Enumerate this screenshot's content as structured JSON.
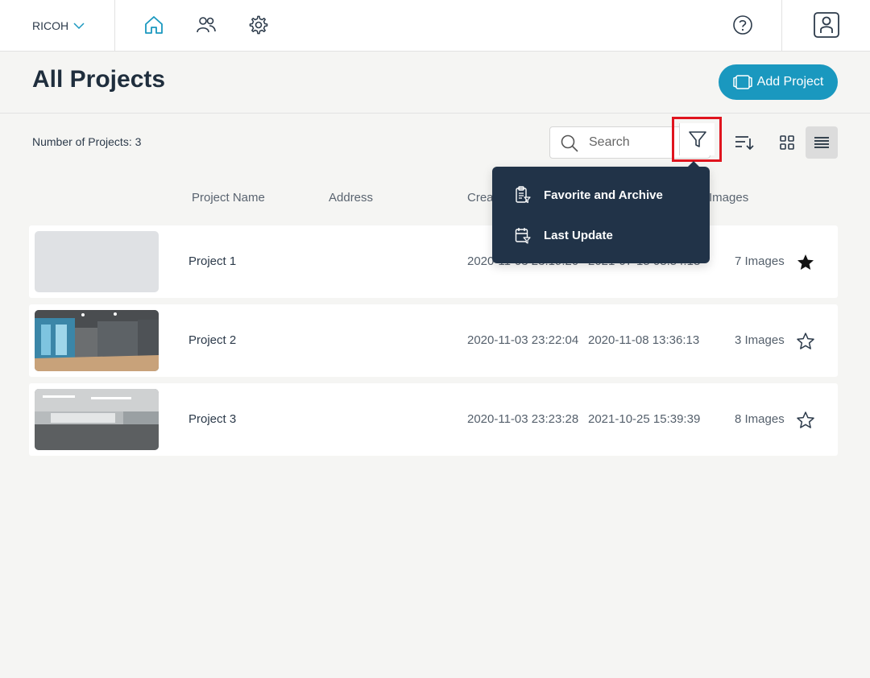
{
  "topbar": {
    "org_name": "RICOH",
    "nav_icons": [
      "home-icon",
      "users-icon",
      "settings-icon"
    ],
    "help_icon": "help-icon",
    "user_icon": "user-icon"
  },
  "header": {
    "title": "All Projects",
    "add_button_label": "Add Project"
  },
  "toolbar": {
    "project_count_label": "Number of Projects: 3",
    "search_placeholder": "Search"
  },
  "columns": {
    "name": "Project Name",
    "address": "Address",
    "created": "Crea",
    "images": "Images"
  },
  "filter_menu": {
    "items": [
      {
        "label": "Favorite and Archive",
        "icon": "clipboard-filter-icon"
      },
      {
        "label": "Last Update",
        "icon": "calendar-filter-icon"
      }
    ]
  },
  "projects": [
    {
      "name": "Project 1",
      "created": "2020-11-03 23:19:20",
      "updated": "2021-07-15 08:54:18",
      "images": "7 Images",
      "favorite": true
    },
    {
      "name": "Project 2",
      "created": "2020-11-03 23:22:04",
      "updated": "2020-11-08 13:36:13",
      "images": "3 Images",
      "favorite": false
    },
    {
      "name": "Project 3",
      "created": "2020-11-03 23:23:28",
      "updated": "2021-10-25 15:39:39",
      "images": "8 Images",
      "favorite": false
    }
  ],
  "colors": {
    "accent": "#1a98bf",
    "menu_bg": "#213348",
    "highlight_border": "#e0141e"
  }
}
